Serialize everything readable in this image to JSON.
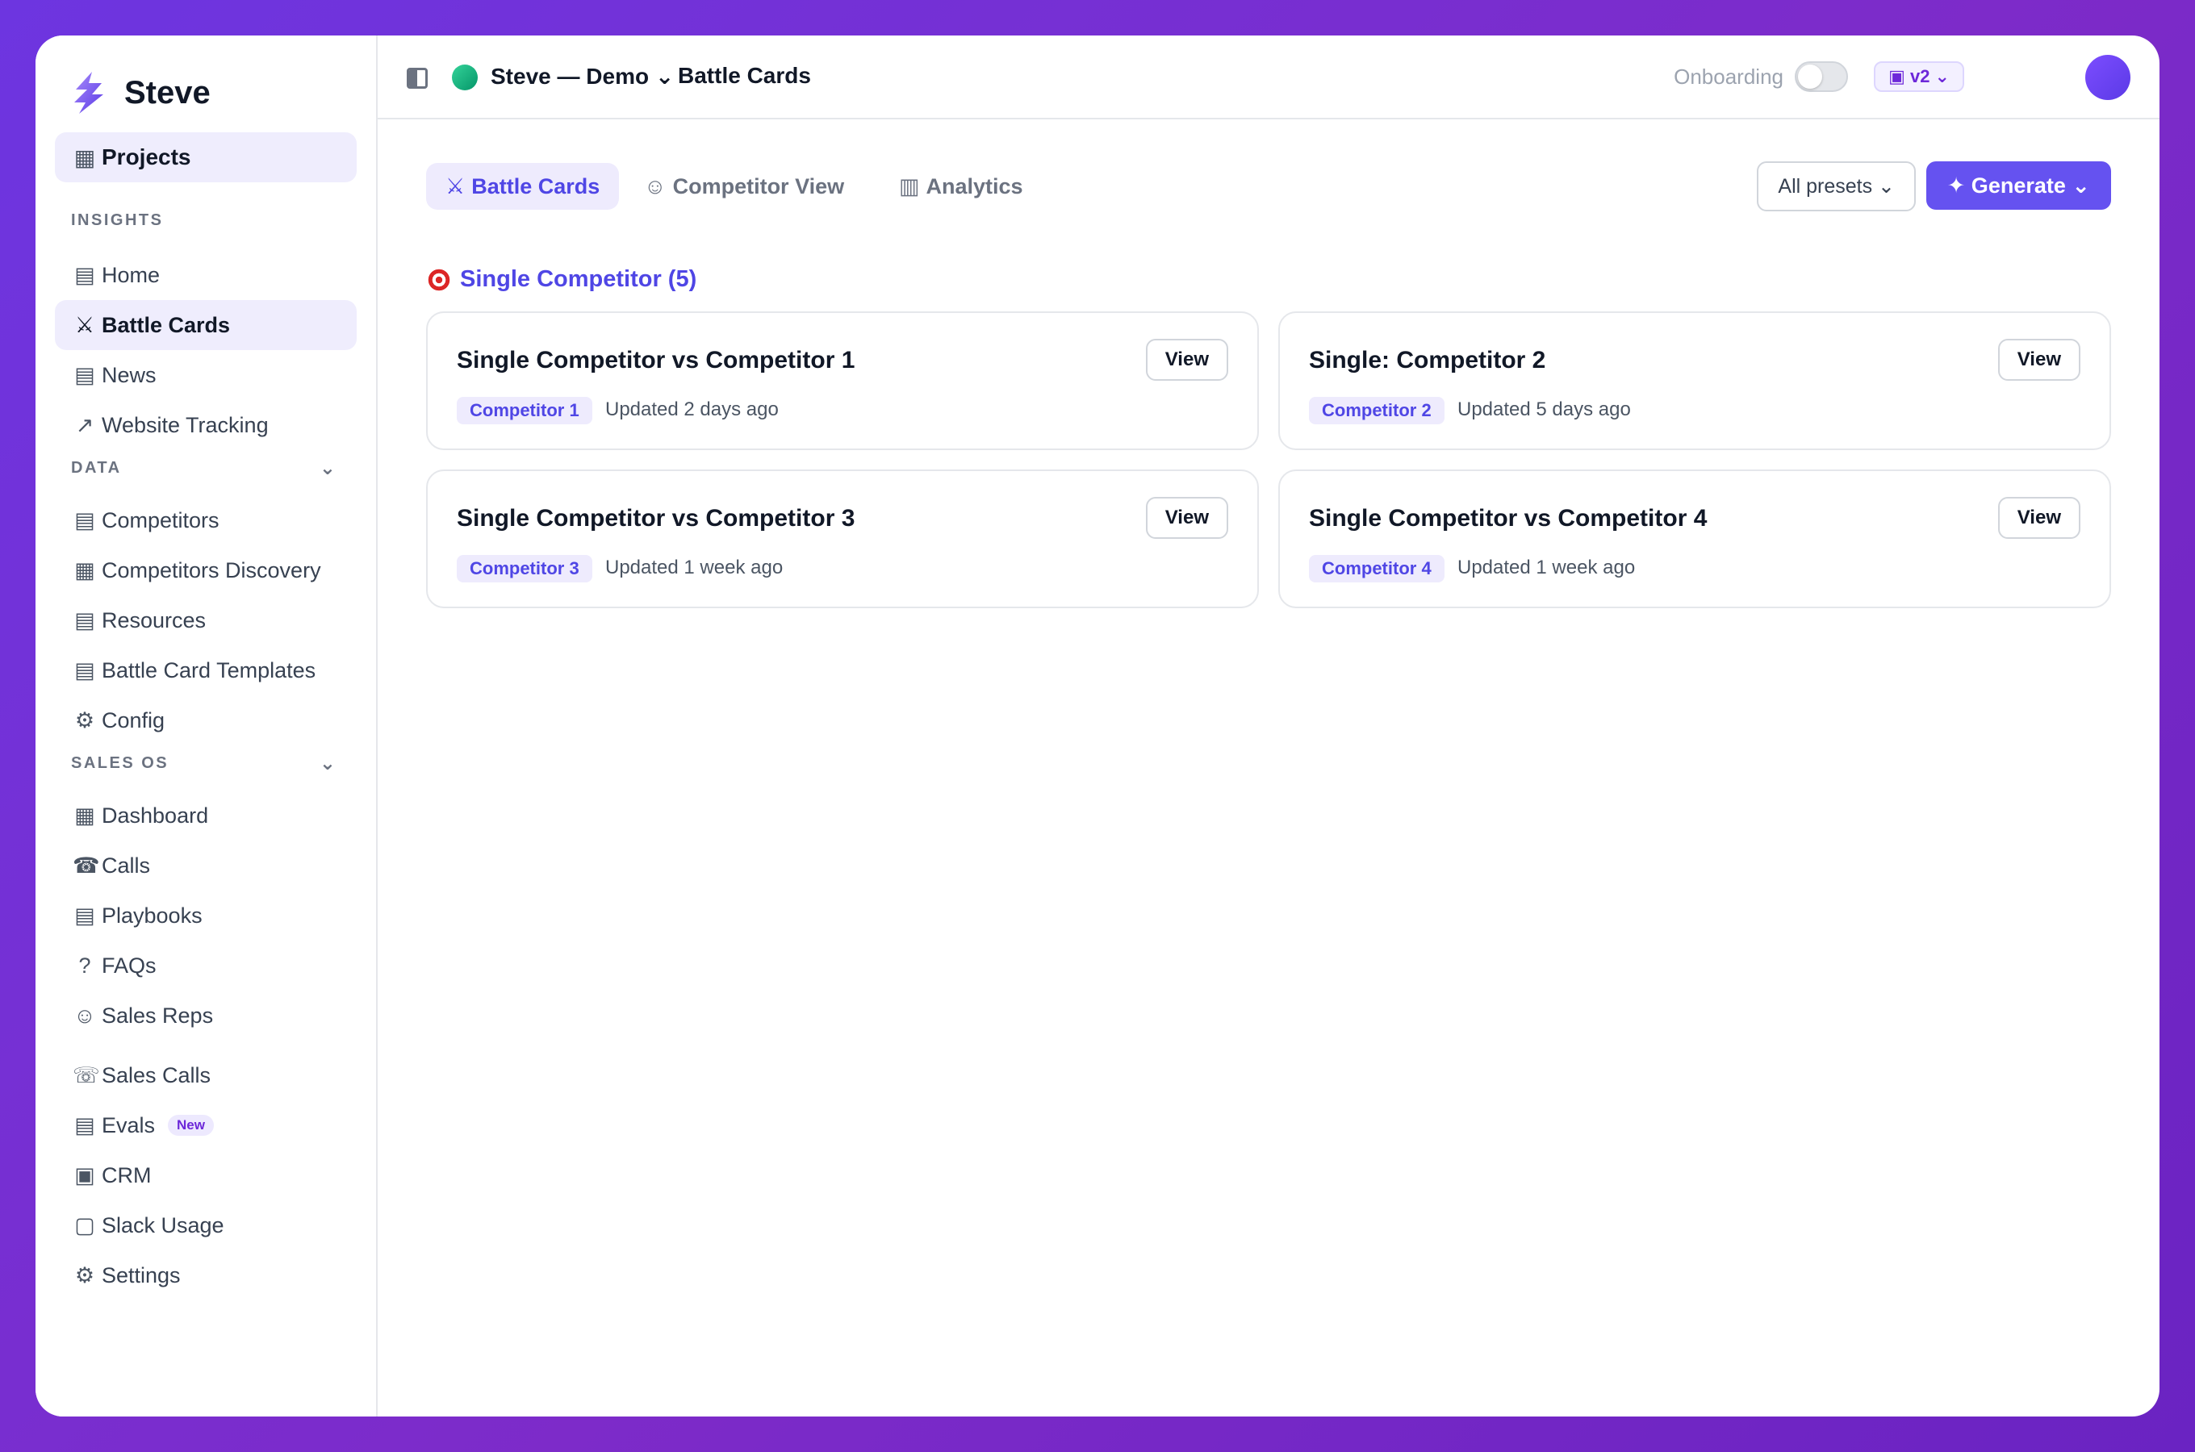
{
  "brand": {
    "name": "Steve",
    "logo_icon": "lightning-logo-icon"
  },
  "sidebar": {
    "projects": {
      "label": "Projects",
      "icon": "▦"
    },
    "sections": [
      {
        "label": "INSIGHTS",
        "chevron": ""
      },
      {
        "label": "DATA",
        "chevron": "⌄"
      },
      {
        "label": "SALES OS",
        "chevron": "⌄"
      }
    ],
    "insights": [
      {
        "label": "Home",
        "icon": "▤"
      },
      {
        "label": "Battle Cards",
        "icon": "⚔"
      },
      {
        "label": "News",
        "icon": "▤"
      },
      {
        "label": "Website Tracking",
        "icon": "↗"
      }
    ],
    "data": [
      {
        "label": "Competitors",
        "icon": "▤"
      },
      {
        "label": "Competitors Discovery",
        "icon": "▦"
      },
      {
        "label": "Resources",
        "icon": "▤"
      },
      {
        "label": "Battle Card Templates",
        "icon": "▤"
      },
      {
        "label": "Config",
        "icon": "⚙"
      }
    ],
    "sales_os": [
      {
        "label": "Dashboard",
        "icon": "▦"
      },
      {
        "label": "Calls",
        "icon": "☎"
      },
      {
        "label": "Playbooks",
        "icon": "▤"
      },
      {
        "label": "FAQs",
        "icon": "?"
      },
      {
        "label": "Sales Reps",
        "icon": "☺"
      },
      {
        "label": "Sales Calls",
        "icon": "☏"
      },
      {
        "label": "Evals",
        "icon": "▤",
        "badge": "New"
      },
      {
        "label": "CRM",
        "icon": "▣"
      },
      {
        "label": "Slack Usage",
        "icon": "▢"
      },
      {
        "label": "Settings",
        "icon": "⚙"
      }
    ]
  },
  "topbar": {
    "project_name": "Steve — Demo ⌄",
    "breadcrumb": "Battle Cards",
    "onboarding_label": "Onboarding",
    "onboarding_enabled": false,
    "version": "▣ v2 ⌄"
  },
  "tabs": [
    {
      "label": "Battle Cards",
      "icon": "⚔",
      "active": true
    },
    {
      "label": "Competitor View",
      "icon": "☺",
      "active": false
    },
    {
      "label": "Analytics",
      "icon": "▥",
      "active": false
    }
  ],
  "toolbar": {
    "presets_label": "All presets ⌄",
    "generate_label": "✦ Generate ⌄"
  },
  "group": {
    "title": "Single Competitor (5)"
  },
  "cards": [
    {
      "title": "Single Competitor vs Competitor 1",
      "chip": "Competitor 1",
      "updated": "Updated 2 days ago",
      "view_label": "View"
    },
    {
      "title": "Single: Competitor 2",
      "chip": "Competitor 2",
      "updated": "Updated 5 days ago",
      "view_label": "View"
    },
    {
      "title": "Single Competitor vs Competitor 3",
      "chip": "Competitor 3",
      "updated": "Updated 1 week ago",
      "view_label": "View"
    },
    {
      "title": "Single Competitor vs Competitor 4",
      "chip": "Competitor 4",
      "updated": "Updated 1 week ago",
      "view_label": "View"
    }
  ],
  "colors": {
    "accent": "#6552f0",
    "accent_text": "#4f46e5",
    "active_bg": "#efedfd",
    "project_dot": "#10b981"
  }
}
